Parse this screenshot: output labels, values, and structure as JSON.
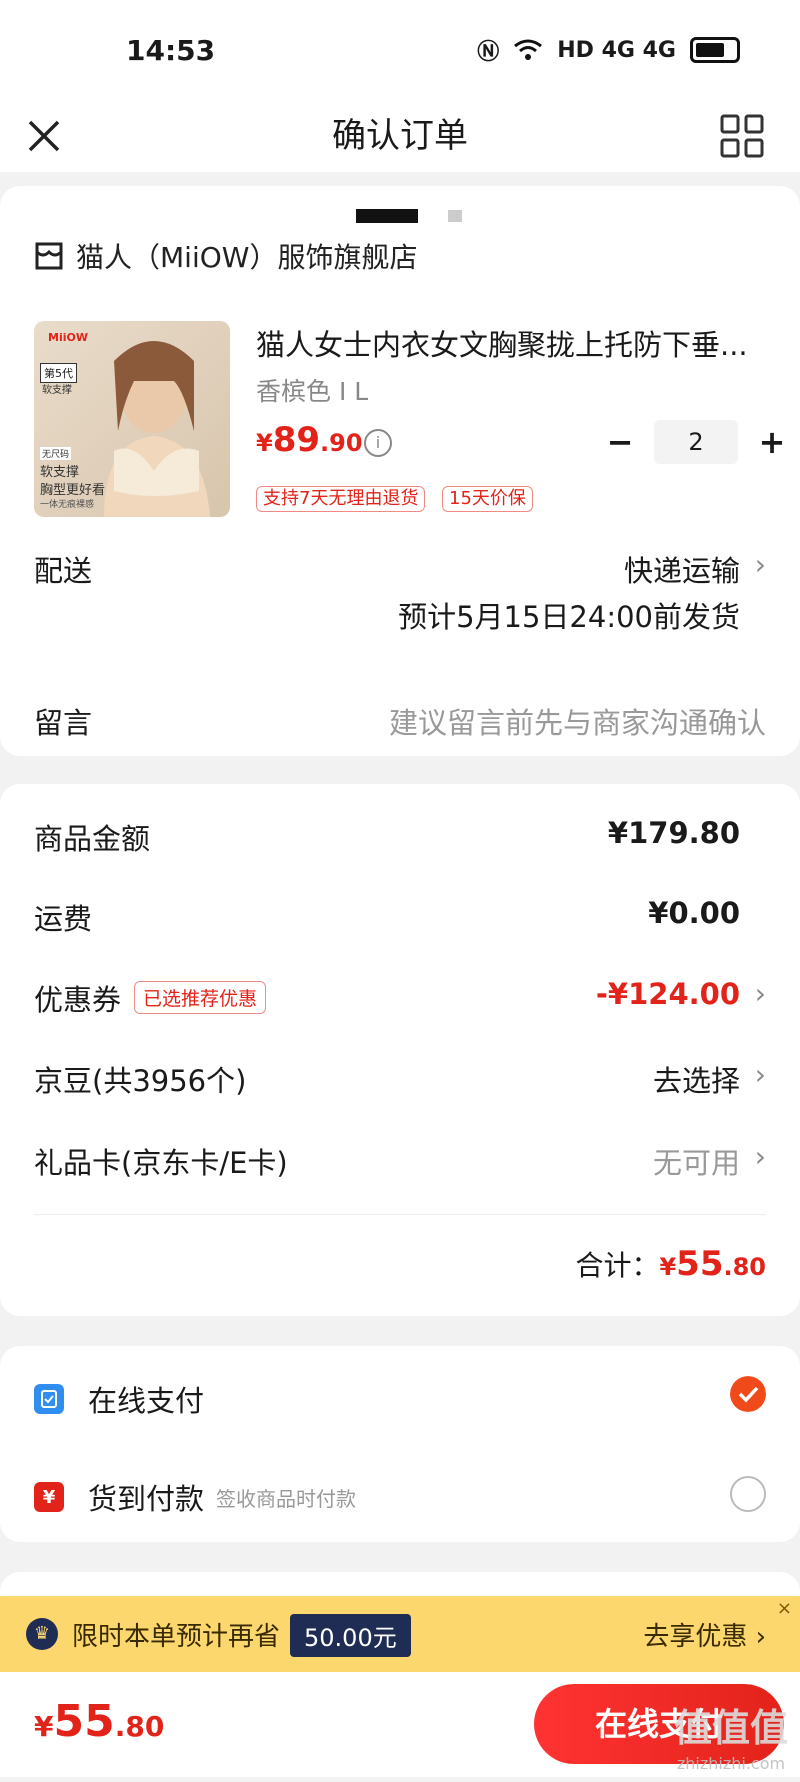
{
  "status_bar": {
    "time": "14:53",
    "network": "HD 4G 4G"
  },
  "header": {
    "title": "确认订单",
    "close_icon": "close-icon",
    "menu_icon": "grid-icon"
  },
  "store": {
    "name": "猫人（MiiOW）服饰旗舰店"
  },
  "product": {
    "title": "猫人女士内衣女文胸聚拢上托防下垂...",
    "variant": "香槟色 I L",
    "price_yen": "¥",
    "price_int": "89",
    "price_dec": ".90",
    "quantity": "2",
    "tags": [
      "支持7天无理由退货",
      "15天价保"
    ],
    "image_text": {
      "gen": "第5代",
      "sub": "软支撑",
      "promo": [
        "无尺码",
        "软支撑",
        "胸型更好看",
        "一体无痕裸感"
      ]
    }
  },
  "delivery": {
    "label": "配送",
    "method": "快递运输",
    "eta": "预计5月15日24:00前发货"
  },
  "message": {
    "label": "留言",
    "placeholder": "建议留言前先与商家沟通确认"
  },
  "summary": {
    "goods_label": "商品金额",
    "goods_value": "¥179.80",
    "shipping_label": "运费",
    "shipping_value": "¥0.00",
    "coupon_label": "优惠券",
    "coupon_tag": "已选推荐优惠",
    "coupon_value": "-¥124.00",
    "jd_beans_label": "京豆(共3956个)",
    "jd_beans_value": "去选择",
    "giftcard_label": "礼品卡(京东卡/E卡)",
    "giftcard_value": "无可用",
    "total_label": "合计：",
    "total_yen": "¥",
    "total_int": "55",
    "total_dec": ".80"
  },
  "payment": {
    "online_label": "在线支付",
    "cod_label": "货到付款",
    "cod_sub": "签收商品时付款",
    "cod_icon_text": "¥"
  },
  "promo": {
    "text": "限时本单预计再省",
    "amount": "50.00元",
    "link": "去享优惠",
    "close": "×"
  },
  "bottom": {
    "yen": "¥",
    "int": "55",
    "dec": ".80",
    "submit": "在线支付"
  },
  "watermark": {
    "main": "值值值",
    "sub": "zhizhizhi.com"
  },
  "colors": {
    "accent": "#e2231a",
    "promo_bg": "#fbd76d",
    "promo_dark": "#1f2d55",
    "online_icon": "#2f8ef0",
    "cod_icon": "#e2231a"
  }
}
